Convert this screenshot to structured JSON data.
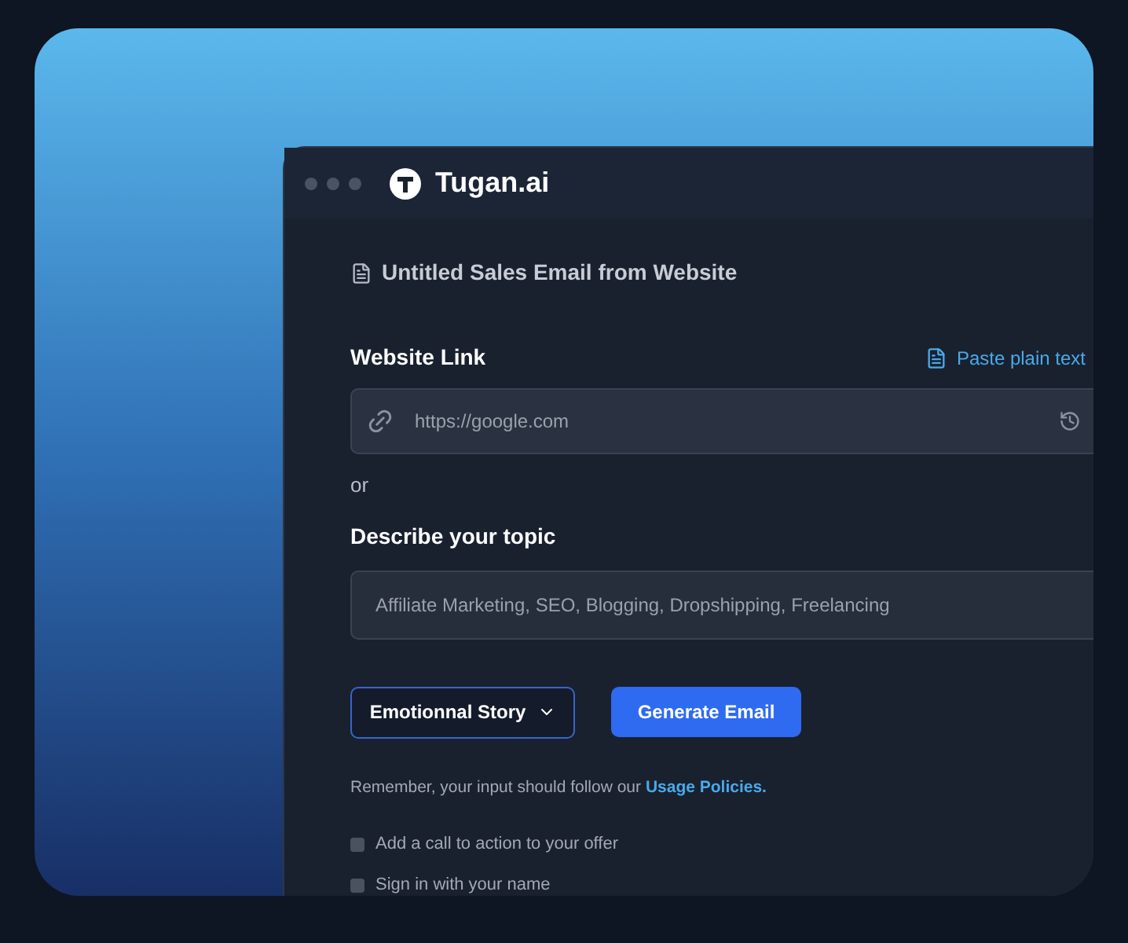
{
  "window": {
    "title": "Tugan.ai"
  },
  "document": {
    "title": "Untitled Sales Email from Website"
  },
  "website": {
    "label": "Website Link",
    "paste_link": "Paste plain text",
    "placeholder": "https://google.com"
  },
  "separator": "or",
  "topic": {
    "label": "Describe your topic",
    "placeholder": "Affiliate Marketing, SEO, Blogging, Dropshipping, Freelancing"
  },
  "style_select": {
    "value": "Emotionnal Story"
  },
  "generate_button": "Generate Email",
  "notice": {
    "text": "Remember, your input should follow our",
    "link": "Usage Policies."
  },
  "options": [
    {
      "label": "Add a call to action to your offer",
      "checked": false
    },
    {
      "label": "Sign in with your name",
      "checked": false
    }
  ]
}
